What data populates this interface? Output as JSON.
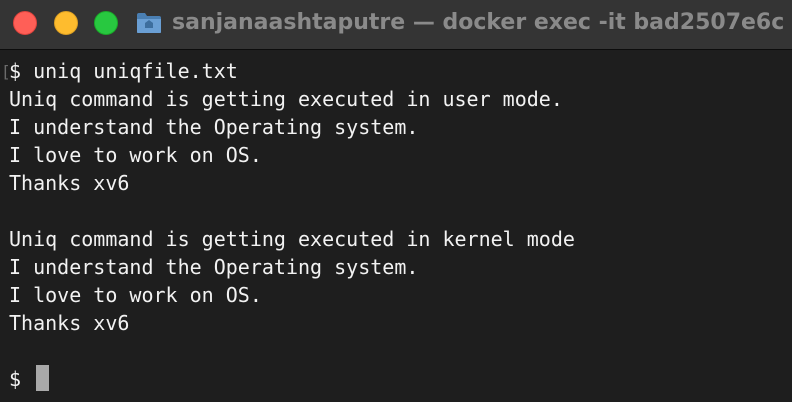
{
  "window": {
    "title": "sanjanaashtaputre — docker exec -it bad2507e6c",
    "folder_icon": "folder-icon",
    "buttons": {
      "close_color": "#ff5f57",
      "minimize_color": "#febc2e",
      "maximize_color": "#28c840"
    }
  },
  "terminal": {
    "marker": "[",
    "lines": [
      "$ uniq uniqfile.txt",
      "Uniq command is getting executed in user mode.",
      "I understand the Operating system.",
      "I love to work on OS.",
      "Thanks xv6",
      "",
      "Uniq command is getting executed in kernel mode",
      "I understand the Operating system.",
      "I love to work on OS.",
      "Thanks xv6",
      "",
      "$ "
    ]
  }
}
